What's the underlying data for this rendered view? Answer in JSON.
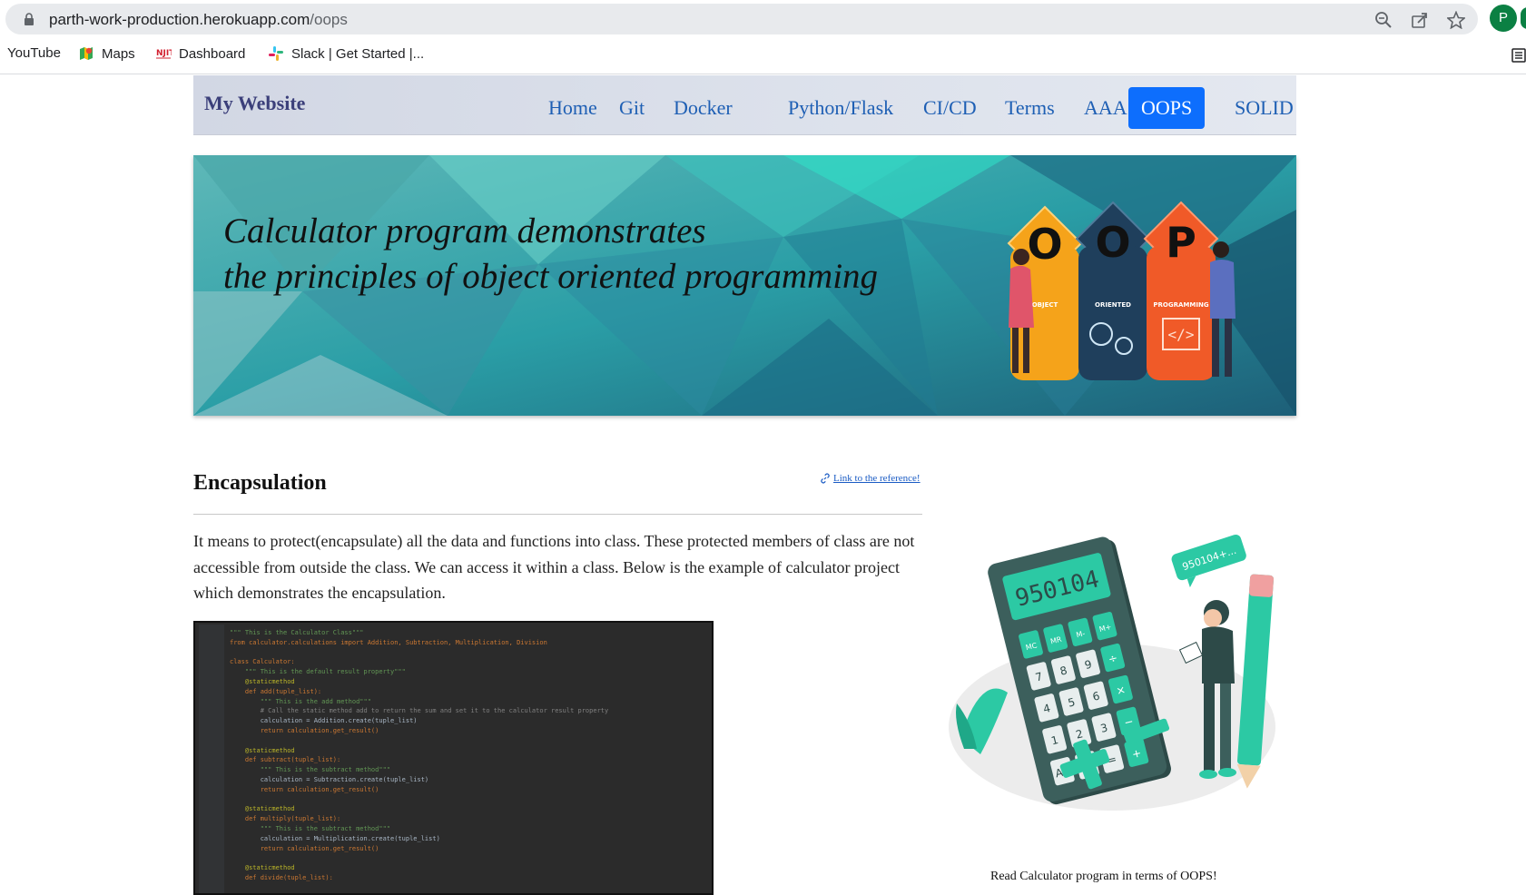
{
  "browser": {
    "url_host": "parth-work-production.herokuapp.com",
    "url_path": "/oops",
    "profile_initial": "P",
    "bookmarks": [
      {
        "label": "YouTube"
      },
      {
        "label": "Maps"
      },
      {
        "label": "Dashboard"
      },
      {
        "label": "Slack | Get Started |..."
      }
    ]
  },
  "site": {
    "brand": "My Website",
    "nav": [
      {
        "label": "Home",
        "active": false
      },
      {
        "label": "Git",
        "active": false
      },
      {
        "label": "Docker",
        "active": false
      },
      {
        "label": "Python/Flask",
        "active": false
      },
      {
        "label": "CI/CD",
        "active": false
      },
      {
        "label": "Terms",
        "active": false
      },
      {
        "label": "AAA",
        "active": false
      },
      {
        "label": "OOPS",
        "active": true
      },
      {
        "label": "SOLID",
        "active": false
      }
    ],
    "active_color": "#0d6efd",
    "link_color": "#1e5fb4"
  },
  "banner": {
    "line1": "Calculator program demonstrates",
    "line2": "the principles of object oriented programming",
    "oop_letters": [
      "O",
      "O",
      "P"
    ],
    "oop_words": [
      "OBJECT",
      "ORIENTED",
      "PROGRAMMING"
    ],
    "oop_colors": [
      "#f5a31a",
      "#1f3f5c",
      "#f05a28"
    ]
  },
  "content": {
    "title": "Encapsulation",
    "reference_link": "Link to the reference!",
    "paragraph": "It means to protect(encapsulate) all the data and functions into class. These protected members of class are not accessible from outside the class. We can access it within a class. Below is the example of calculator project which demonstrates the encapsulation.",
    "code_lines": [
      "\"\"\" This is the Calculator Class\"\"\"",
      "from calculator.calculations import Addition, Subtraction, Multiplication, Division",
      "",
      "class Calculator:",
      "    \"\"\" This is the default result property\"\"\"",
      "    @staticmethod",
      "    def add(tuple_list):",
      "        \"\"\" This is the add method\"\"\"",
      "        # Call the static method add to return the sum and set it to the calculator result property",
      "        calculation = Addition.create(tuple_list)",
      "        return calculation.get_result()",
      "",
      "    @staticmethod",
      "    def subtract(tuple_list):",
      "        \"\"\" This is the subtract method\"\"\"",
      "        calculation = Subtraction.create(tuple_list)",
      "        return calculation.get_result()",
      "",
      "    @staticmethod",
      "    def multiply(tuple_list):",
      "        \"\"\" This is the subtract method\"\"\"",
      "        calculation = Multiplication.create(tuple_list)",
      "        return calculation.get_result()",
      "",
      "    @staticmethod",
      "    def divide(tuple_list):"
    ],
    "caption": "Read Calculator program in terms of OOPS!",
    "calc_display": "950104",
    "speech_bubble": "950104+...",
    "calc_keys": [
      "MC",
      "MR",
      "M-",
      "M+",
      "7",
      "8",
      "9",
      "÷",
      "4",
      "5",
      "6",
      "×",
      "1",
      "2",
      "3",
      "−",
      "AC",
      "0",
      "=",
      "+"
    ]
  }
}
